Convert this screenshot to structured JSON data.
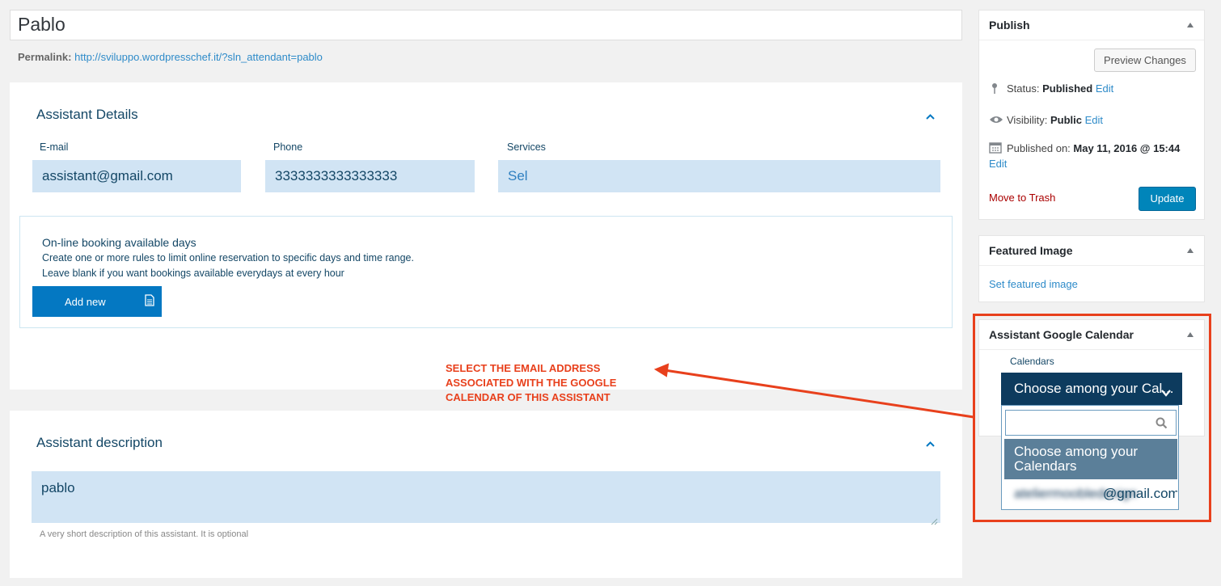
{
  "post": {
    "title": "Pablo",
    "permalink_label": "Permalink:",
    "permalink_url": "http://sviluppo.wordpresschef.it/?sln_attendant=pablo"
  },
  "details": {
    "title": "Assistant Details",
    "email_label": "E-mail",
    "email_value": "assistant@gmail.com",
    "phone_label": "Phone",
    "phone_value": "3333333333333333",
    "services_label": "Services",
    "services_value": "Sel"
  },
  "booking": {
    "title": "On-line booking available days",
    "line1": "Create one or more rules to limit online reservation to specific days and time range.",
    "line2": "Leave blank if you want bookings available everydays at every hour",
    "add_label": "Add new"
  },
  "description": {
    "title": "Assistant description",
    "value": "pablo",
    "hint": "A very short description of this assistant. It is optional"
  },
  "annotation": {
    "line1": "SELECT THE EMAIL ADDRESS",
    "line2": "ASSOCIATED WITH THE GOOGLE",
    "line3": "CALENDAR OF THIS ASSISTANT",
    "color": "#e8401c"
  },
  "publish": {
    "title": "Publish",
    "preview_label": "Preview Changes",
    "status_label": "Status:",
    "status_value": "Published",
    "visibility_label": "Visibility:",
    "visibility_value": "Public",
    "published_label": "Published on:",
    "published_value": "May 11, 2016 @ 15:44",
    "edit_label": "Edit",
    "trash_label": "Move to Trash",
    "update_label": "Update"
  },
  "featured": {
    "title": "Featured Image",
    "link_label": "Set featured image"
  },
  "gcal": {
    "title": "Assistant Google Calendar",
    "calendars_label": "Calendars",
    "selected": "Choose among your Cal...",
    "search_placeholder": "",
    "options": [
      "Choose among your Calendars",
      "@gmail.com"
    ],
    "obscured_option_prefix": "ateliermoobledesign"
  },
  "colors": {
    "accent": "#0478c2",
    "field_bg": "#d1e4f4",
    "link": "#2e8bc9",
    "select_bg": "#0d3b5e",
    "highlight_option": "#5b7f99"
  }
}
